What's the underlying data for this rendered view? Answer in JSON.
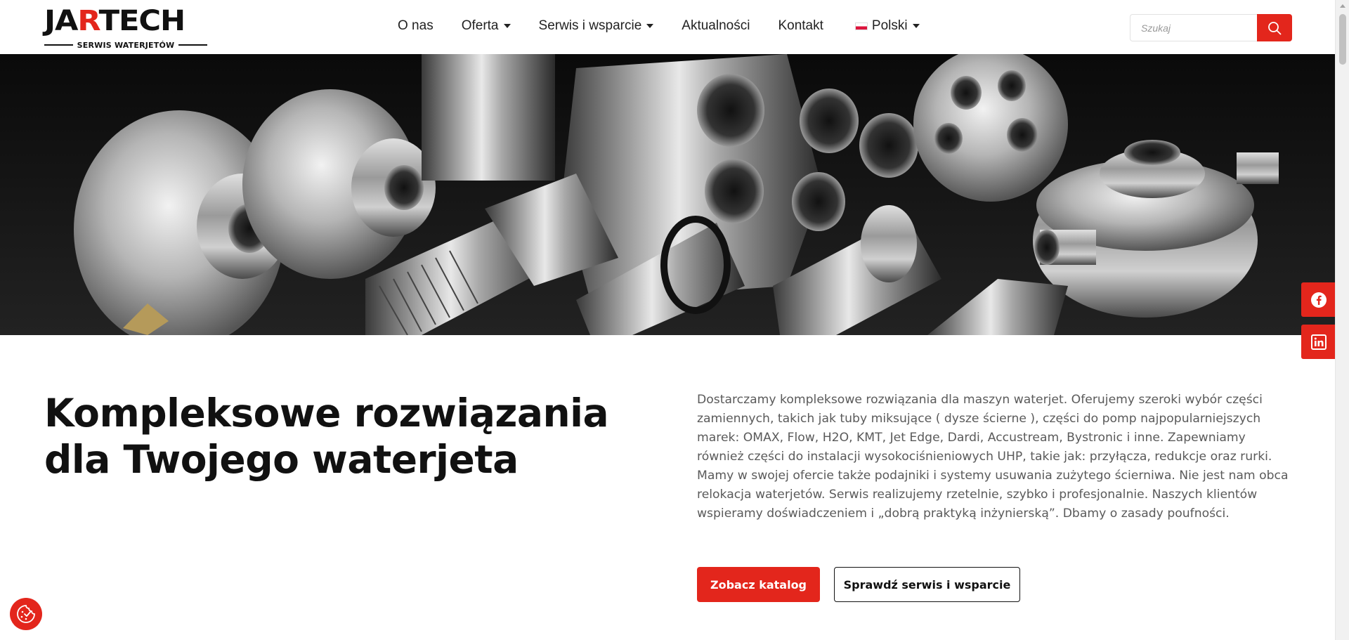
{
  "logo": {
    "name_part1": "JA",
    "name_part2": "R",
    "name_part3": "TECH",
    "tagline": "SERWIS WATERJETÓW"
  },
  "nav": {
    "items": [
      {
        "label": "O nas",
        "dropdown": false
      },
      {
        "label": "Oferta",
        "dropdown": true
      },
      {
        "label": "Serwis i wsparcie",
        "dropdown": true
      },
      {
        "label": "Aktualności",
        "dropdown": false
      },
      {
        "label": "Kontakt",
        "dropdown": false
      }
    ],
    "language": "Polski"
  },
  "search": {
    "placeholder": "Szukaj"
  },
  "social": {
    "icons": [
      "facebook-icon",
      "linkedin-icon"
    ]
  },
  "main": {
    "headline_line1": "Kompleksowe rozwiązania",
    "headline_line2": "dla Twojego waterjeta",
    "paragraph": "Dostarczamy kompleksowe rozwiązania dla maszyn waterjet. Oferujemy szeroki wybór części zamiennych, takich jak tuby miksujące ( dysze ścierne ), części do pomp najpopularniejszych marek: OMAX, Flow, H2O, KMT, Jet Edge, Dardi, Accustream, Bystronic i inne. Zapewniamy również części do instalacji wysokociśnieniowych UHP, takie jak: przyłącza, redukcje oraz rurki. Mamy w swojej ofercie także podajniki i systemy usuwania zużytego ściernіwa. Nie jest nam obca relokacja waterjetów. Serwis realizujemy rzetelnie, szybko i profesjonalnie. Naszych klientów wspieramy doświadczeniem i „dobrą praktyką inżynierską”. Dbamy o zasady poufności.",
    "primary_button": "Zobacz katalog",
    "secondary_button": "Sprawdź serwis i wsparcie"
  },
  "colors": {
    "accent": "#e3261c",
    "text": "#111111",
    "body_text": "#5a5a5a"
  }
}
